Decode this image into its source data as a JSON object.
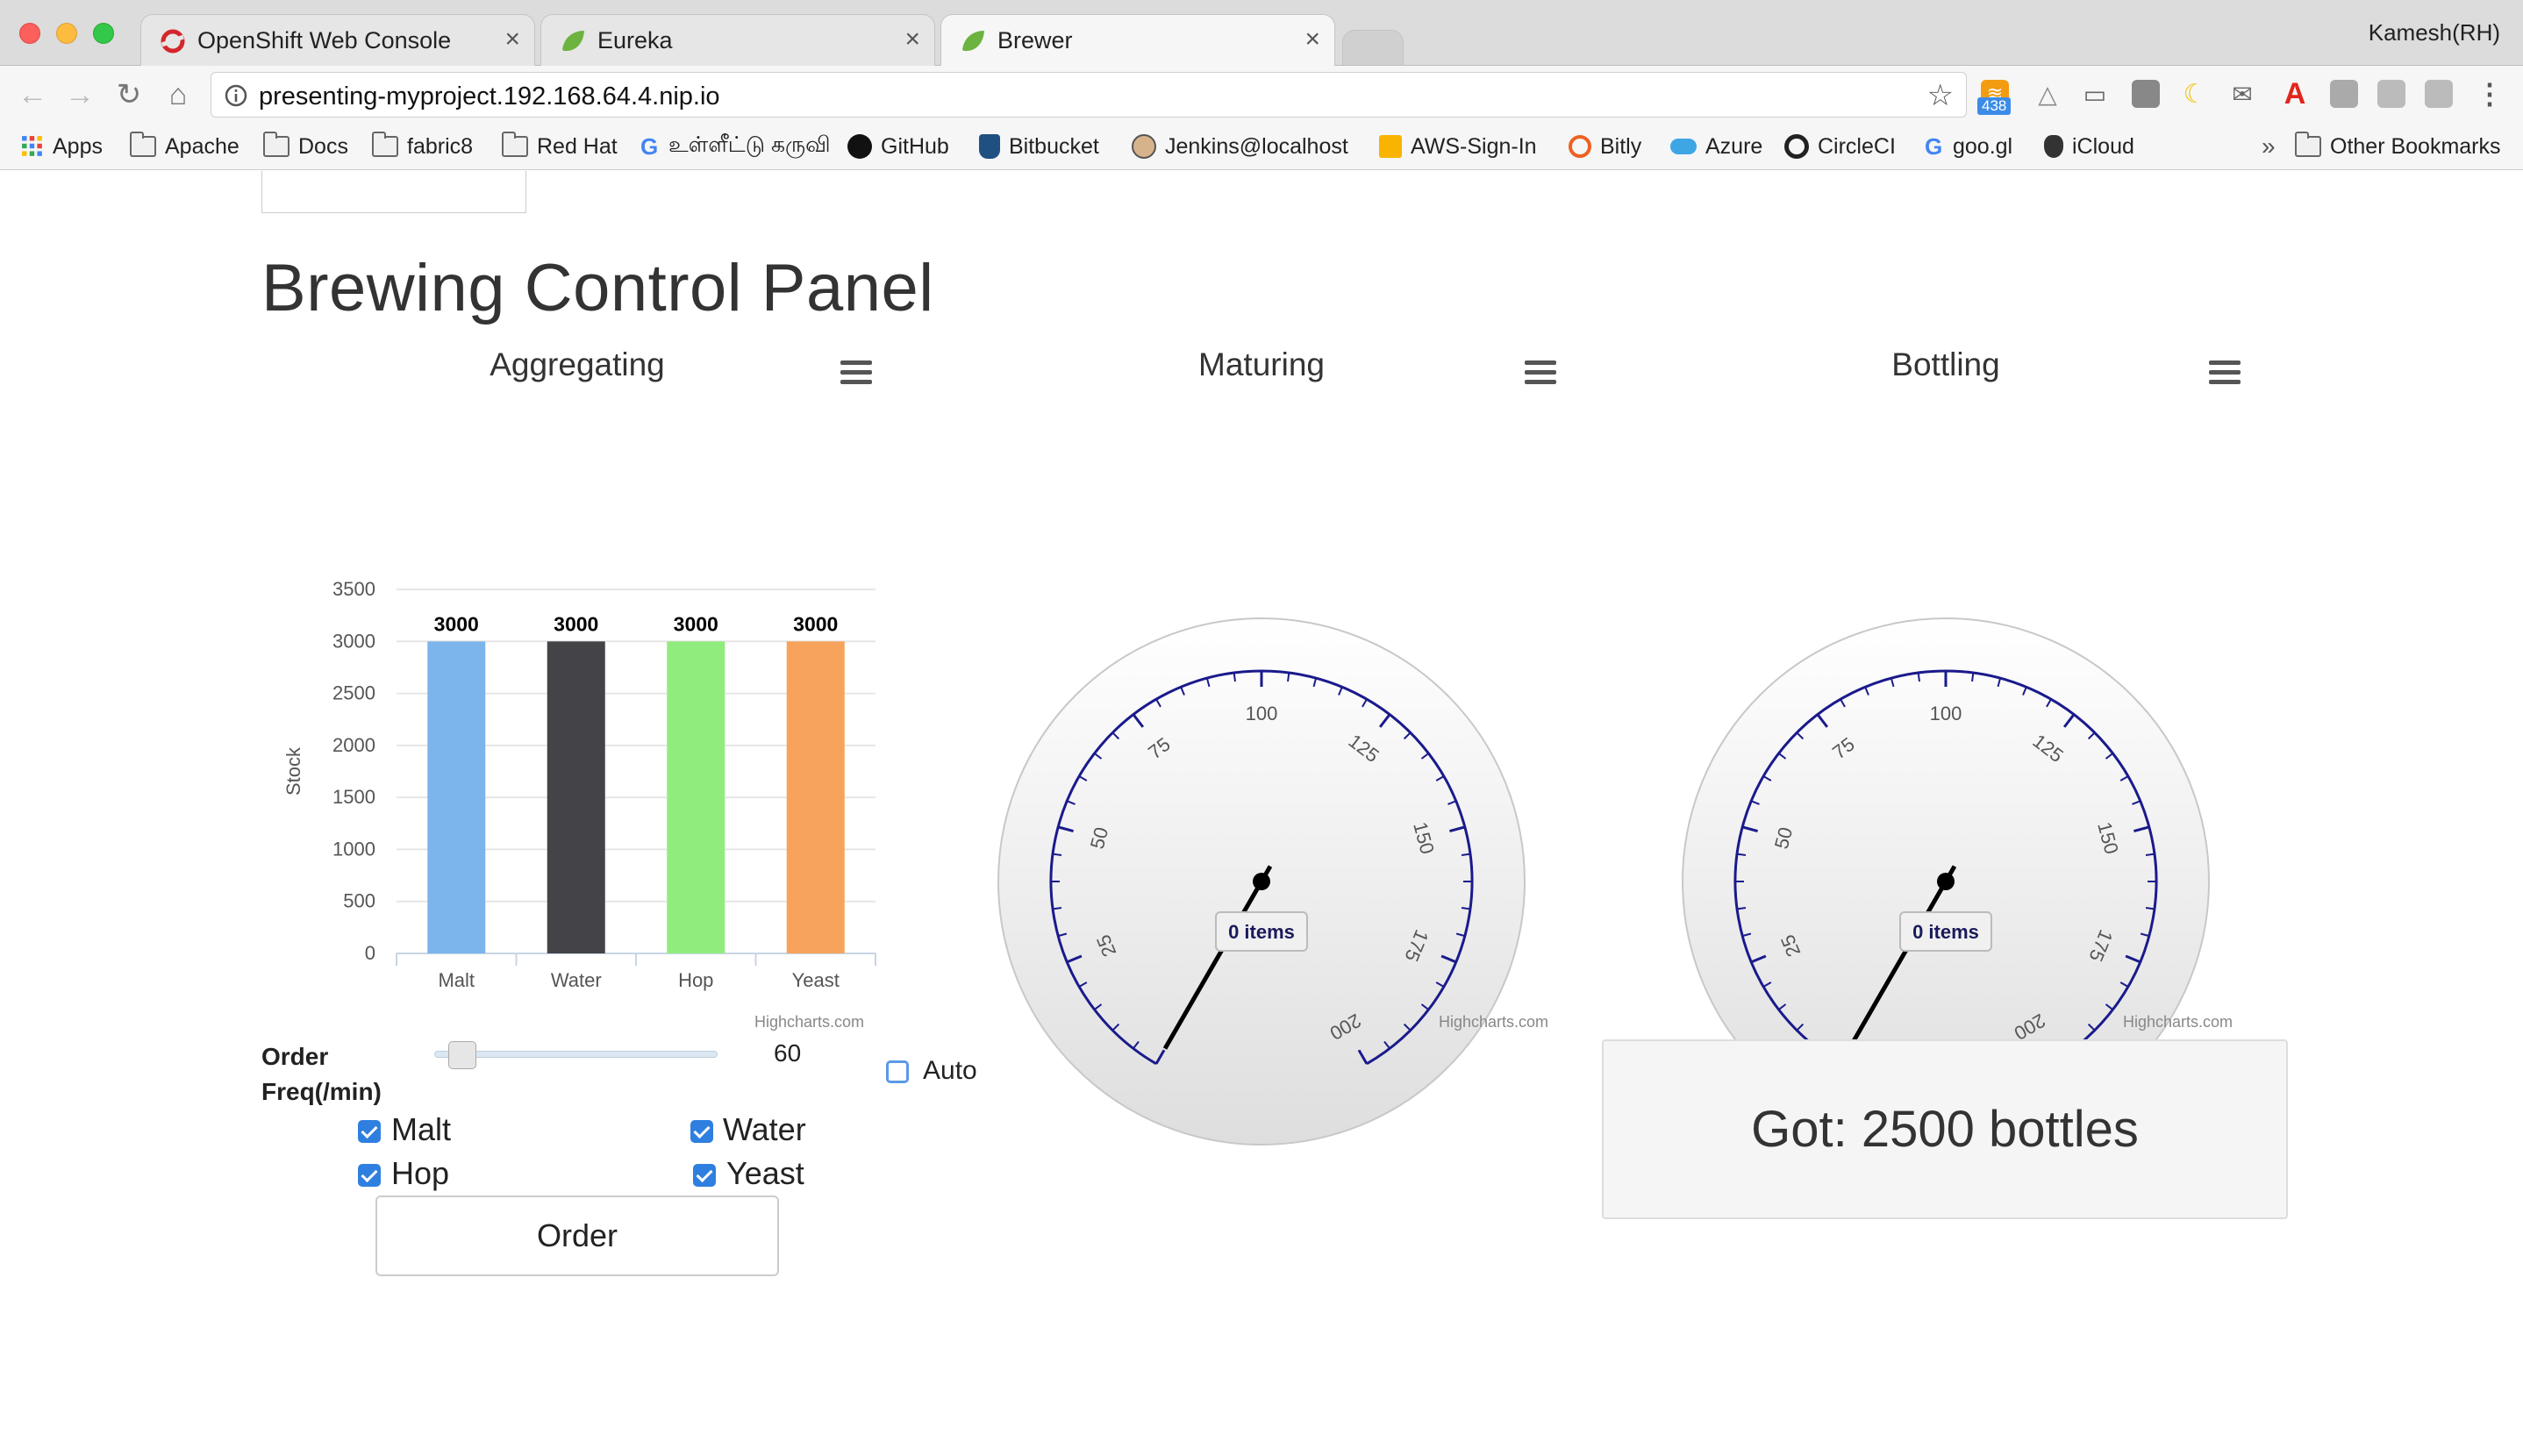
{
  "browser": {
    "tabs": [
      {
        "label": "OpenShift Web Console",
        "icon": "openshift-icon"
      },
      {
        "label": "Eureka",
        "icon": "spring-leaf-icon"
      },
      {
        "label": "Brewer",
        "icon": "spring-leaf-icon"
      }
    ],
    "profile": "Kamesh(RH)",
    "url": "presenting-myproject.192.168.64.4.nip.io",
    "ext_badge": "438",
    "bookmarks": [
      "Apps",
      "Apache",
      "Docs",
      "fabric8",
      "Red Hat",
      "உள்ளீட்டு கருவி",
      "GitHub",
      "Bitbucket",
      "Jenkins@localhost",
      "AWS-Sign-In",
      "Bitly",
      "Azure",
      "CircleCI",
      "goo.gl",
      "iCloud"
    ],
    "overflow": "»",
    "other_bookmarks": "Other Bookmarks"
  },
  "page": {
    "title": "Brewing Control Panel",
    "credits": "Highcharts.com"
  },
  "chart_data": [
    {
      "type": "bar",
      "title": "Aggregating",
      "categories": [
        "Malt",
        "Water",
        "Hop",
        "Yeast"
      ],
      "values": [
        3000,
        3000,
        3000,
        3000
      ],
      "colors": [
        "#7cb5ec",
        "#434348",
        "#90ed7d",
        "#f7a35c"
      ],
      "ylabel": "Stock",
      "ylim": [
        0,
        3500
      ],
      "yticks": [
        0,
        500,
        1000,
        1500,
        2000,
        2500,
        3000,
        3500
      ],
      "data_labels": [
        "3000",
        "3000",
        "3000",
        "3000"
      ]
    },
    {
      "type": "gauge",
      "title": "Maturing",
      "value": 0,
      "range": [
        0,
        200
      ],
      "ticks": [
        "25",
        "50",
        "75",
        "100",
        "125",
        "150",
        "175",
        "200"
      ],
      "label": "0 items"
    },
    {
      "type": "gauge",
      "title": "Bottling",
      "value": 0,
      "range": [
        0,
        200
      ],
      "ticks": [
        "25",
        "50",
        "75",
        "100",
        "125",
        "150",
        "175",
        "200"
      ],
      "label": "0 items"
    }
  ],
  "controls": {
    "order_label_line1": "Order",
    "order_label_line2": "Freq(/min)",
    "frequency": "60",
    "frequency_fraction": 0.08,
    "auto_label": "Auto",
    "auto_checked": false,
    "ingredients": [
      {
        "label": "Malt",
        "checked": true
      },
      {
        "label": "Water",
        "checked": true
      },
      {
        "label": "Hop",
        "checked": true
      },
      {
        "label": "Yeast",
        "checked": true
      }
    ],
    "order_button": "Order"
  },
  "status": {
    "got_text": "Got: 2500 bottles"
  }
}
